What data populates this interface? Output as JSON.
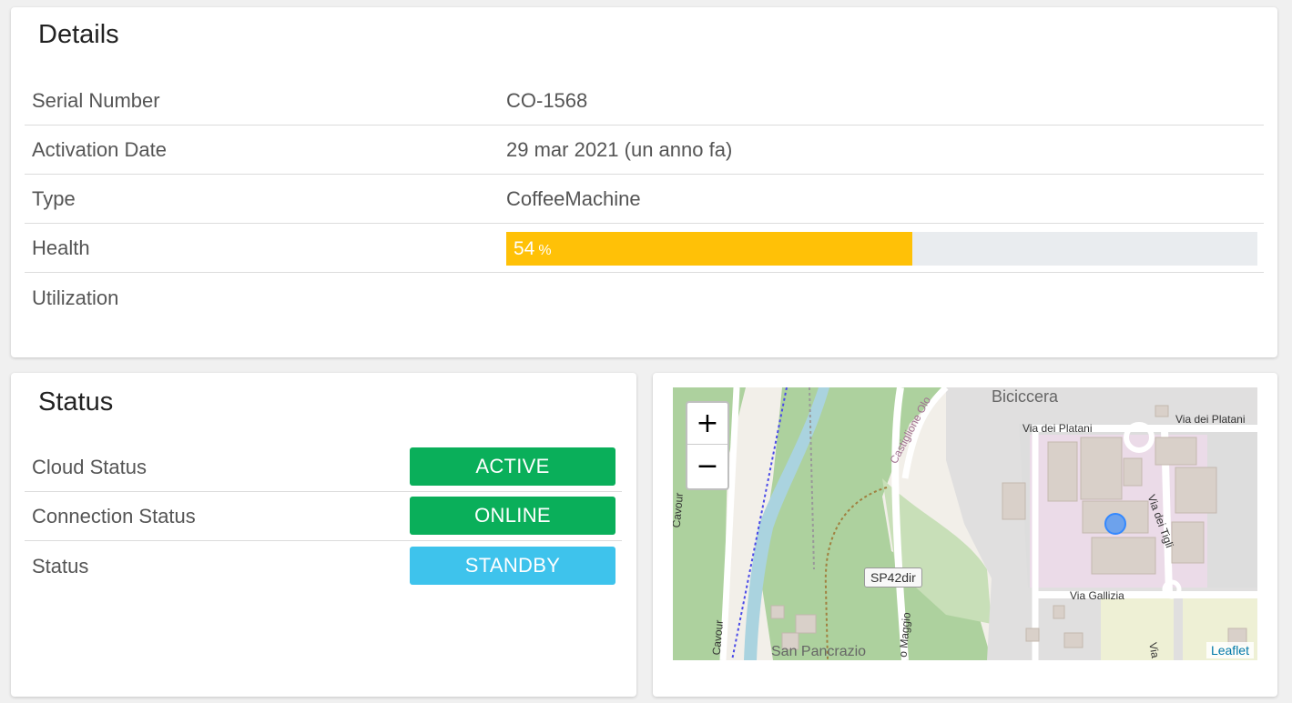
{
  "details": {
    "title": "Details",
    "rows": [
      {
        "label": "Serial Number",
        "value": "CO-1568"
      },
      {
        "label": "Activation Date",
        "value": "29 mar 2021 (un anno fa)"
      },
      {
        "label": "Type",
        "value": "CoffeeMachine"
      },
      {
        "label": "Health",
        "value": "54",
        "unit": "%"
      },
      {
        "label": "Utilization",
        "value": ""
      }
    ],
    "health_percent": 54,
    "health_color": "#ffc107"
  },
  "status": {
    "title": "Status",
    "rows": [
      {
        "label": "Cloud Status",
        "badge": "ACTIVE",
        "color": "#0aaf5a"
      },
      {
        "label": "Connection Status",
        "badge": "ONLINE",
        "color": "#0aaf5a"
      },
      {
        "label": "Status",
        "badge": "STANDBY",
        "color": "#3ec3ec"
      }
    ]
  },
  "map": {
    "zoom_in": "+",
    "zoom_out": "−",
    "attribution": "Leaflet",
    "labels": {
      "place1": "Biciccera",
      "place2": "San Pancrazio",
      "street1": "Via dei Platani",
      "street2": "Via dei Platani",
      "street3": "Via dei Tigli",
      "street4": "Via Gallizia",
      "street5": "Castiglione Olo",
      "street6": "o Maggio",
      "street7": "Cavour",
      "street8": "Cavour",
      "street9": "Via",
      "road_sign": "SP42dir"
    }
  }
}
